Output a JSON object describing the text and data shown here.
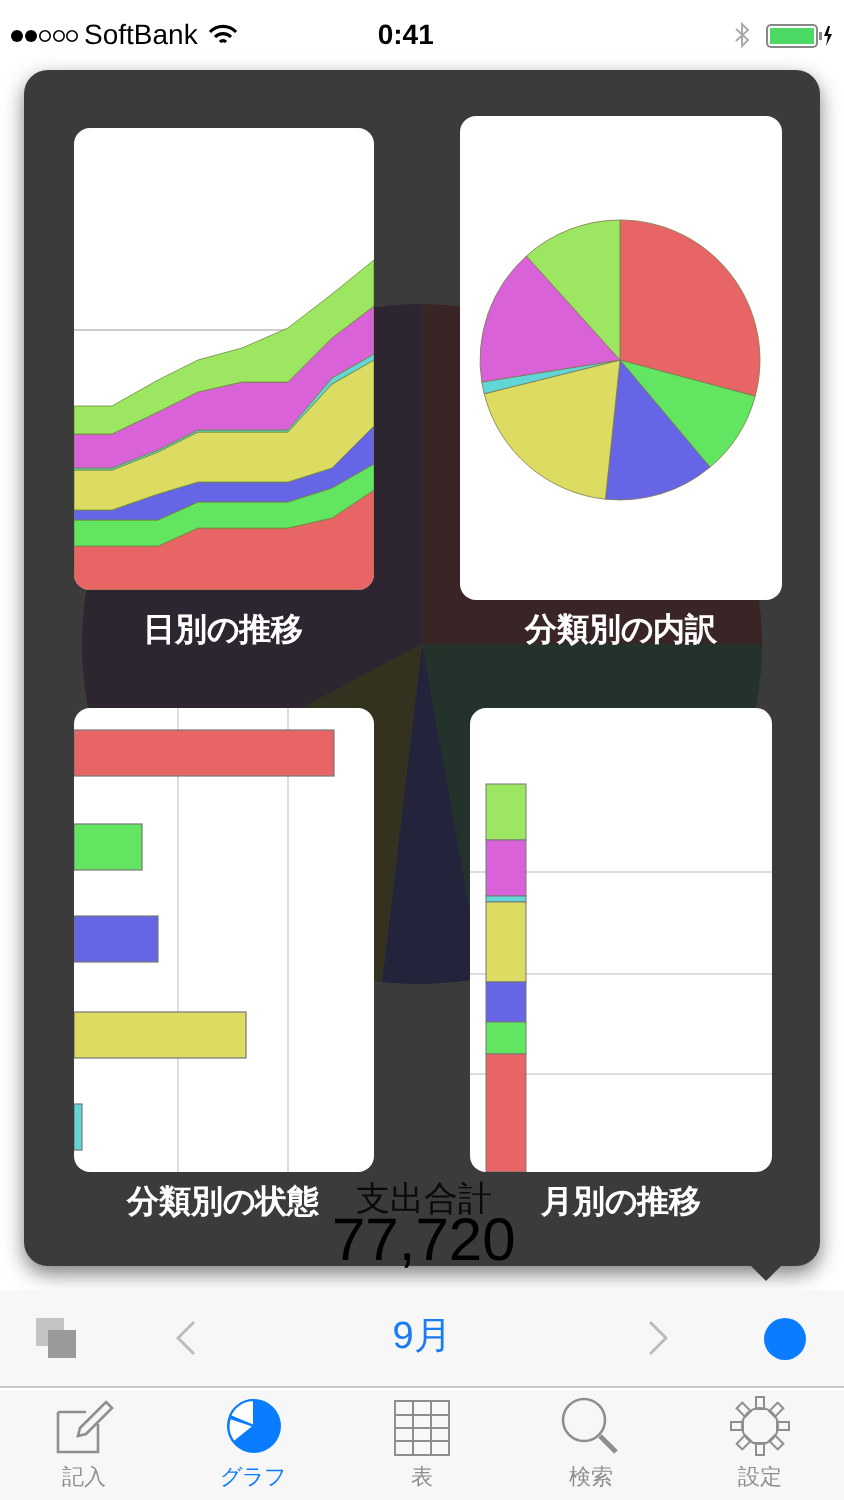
{
  "status_bar": {
    "carrier": "SoftBank",
    "time": "0:41"
  },
  "background": {
    "label": "支出合計",
    "total": "77,720"
  },
  "graph_menu": [
    {
      "title": "日別の推移",
      "kind": "area"
    },
    {
      "title": "分類別の内訳",
      "kind": "pie"
    },
    {
      "title": "分類別の状態",
      "kind": "bar"
    },
    {
      "title": "月別の推移",
      "kind": "stacked"
    }
  ],
  "toolbar": {
    "month": "9月"
  },
  "tabs": [
    {
      "label": "記入",
      "selected": false
    },
    {
      "label": "グラフ",
      "selected": true
    },
    {
      "label": "表",
      "selected": false
    },
    {
      "label": "検索",
      "selected": false
    },
    {
      "label": "設定",
      "selected": false
    }
  ]
}
